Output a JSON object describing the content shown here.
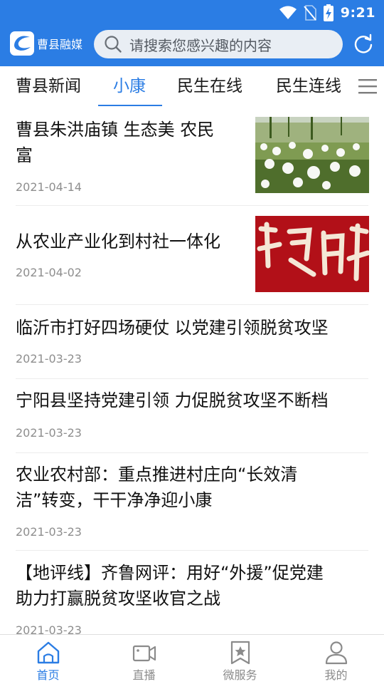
{
  "status": {
    "time": "9:21"
  },
  "app": {
    "name": "曹县融媒"
  },
  "search": {
    "placeholder": "请搜索您感兴趣的内容"
  },
  "tabs": [
    {
      "label": "曹县新闻",
      "active": false
    },
    {
      "label": "小康",
      "active": true
    },
    {
      "label": "民生在线",
      "active": false
    },
    {
      "label": "民生连线",
      "active": false
    }
  ],
  "news": [
    {
      "title_lines": [
        "曹县朱洪庙镇 生态美 农民",
        "富"
      ],
      "date": "2021-04-14",
      "thumb": "flower-field-image"
    },
    {
      "title_lines": [
        "从农业产业化到村社一体化"
      ],
      "date": "2021-04-02",
      "thumb": "red-calligraphy-image"
    },
    {
      "title_lines": [
        "临沂市打好四场硬仗 以党建引领脱贫攻坚"
      ],
      "date": "2021-03-23"
    },
    {
      "title_lines": [
        "宁阳县坚持党建引领 力促脱贫攻坚不断档"
      ],
      "date": "2021-03-23"
    },
    {
      "title_lines": [
        "农业农村部：重点推进村庄向“长效清",
        "洁”转变，干干净净迎小康"
      ],
      "date": "2021-03-23"
    },
    {
      "title_lines": [
        "【地评线】齐鲁网评：用好“外援”促党建",
        "助力打赢脱贫攻坚收官之战"
      ],
      "date": "2021-03-23"
    }
  ],
  "bottom_nav": [
    {
      "label": "首页",
      "icon": "home-icon",
      "active": true
    },
    {
      "label": "直播",
      "icon": "video-icon",
      "active": false
    },
    {
      "label": "微服务",
      "icon": "bookmark-star-icon",
      "active": false
    },
    {
      "label": "我的",
      "icon": "user-icon",
      "active": false
    }
  ],
  "colors": {
    "accent": "#2b7de4",
    "text": "#111111",
    "date": "#8e8e8e"
  }
}
